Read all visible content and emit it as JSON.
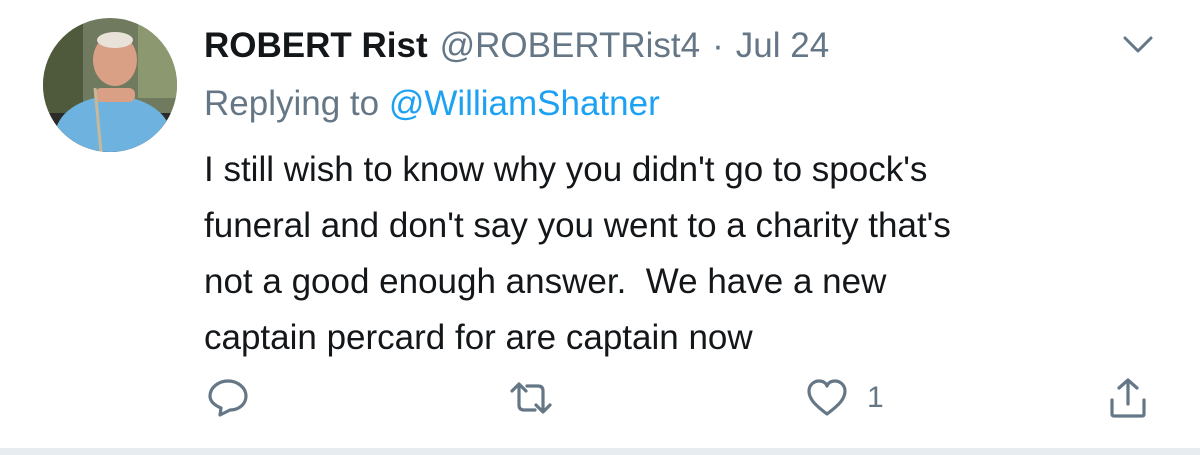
{
  "tweet": {
    "author": {
      "name": "ROBERT Rist",
      "handle": "@ROBERTRist4",
      "avatar_icon": "user-avatar-photo"
    },
    "separator": "·",
    "date": "Jul 24",
    "menu_icon": "chevron-down-icon",
    "reply_prefix": "Replying to",
    "reply_to": "@WilliamShatner",
    "text_lines": [
      "I still wish to know why you didn't go to spock's",
      "funeral and don't say you went to a charity that's",
      "not a good enough answer.  We have a new",
      "captain percard for are captain now"
    ],
    "actions": {
      "reply_icon": "reply-icon",
      "retweet_icon": "retweet-icon",
      "like_icon": "heart-icon",
      "like_count": "1",
      "share_icon": "share-icon"
    },
    "colors": {
      "text": "#14171a",
      "secondary": "#657786",
      "link": "#1da1f2",
      "divider": "#e6ecf0"
    }
  }
}
